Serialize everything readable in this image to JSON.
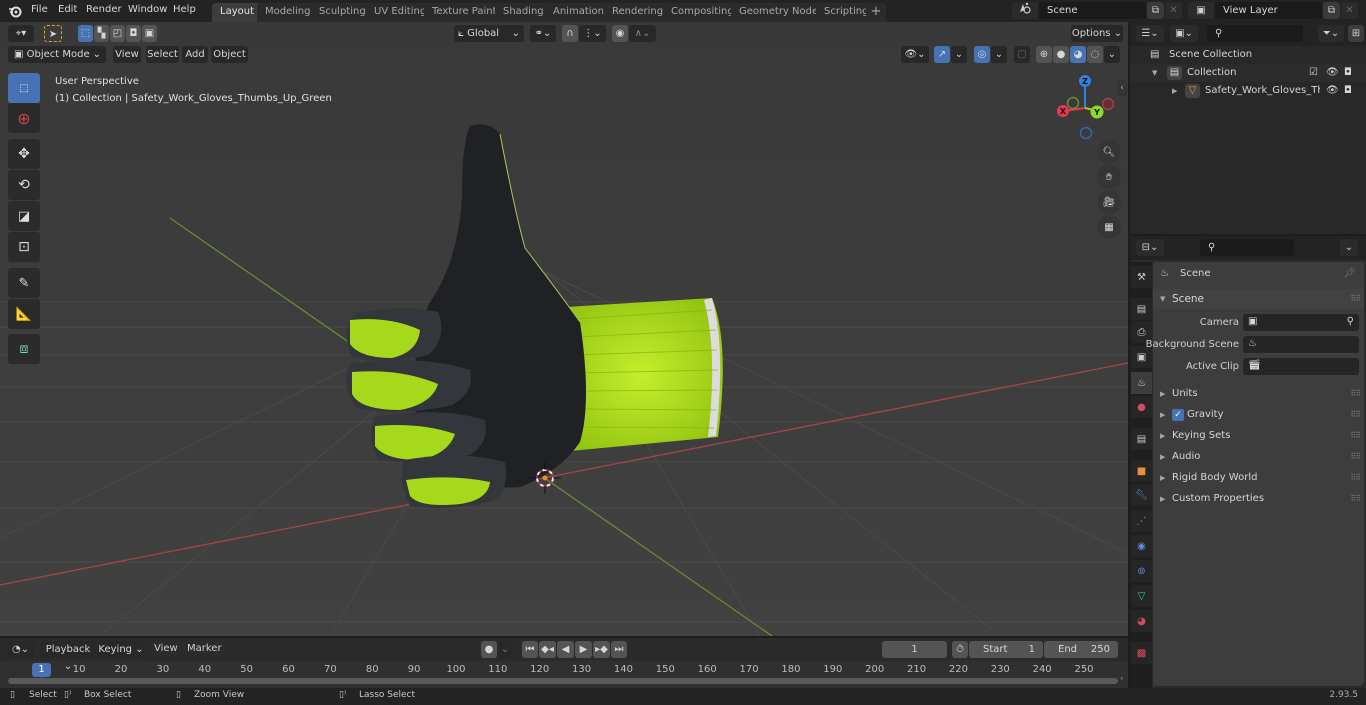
{
  "topbar": {
    "menus": [
      "File",
      "Edit",
      "Render",
      "Window",
      "Help"
    ],
    "workspaces": [
      "Layout",
      "Modeling",
      "Sculpting",
      "UV Editing",
      "Texture Paint",
      "Shading",
      "Animation",
      "Rendering",
      "Compositing",
      "Geometry Nodes",
      "Scripting"
    ],
    "active_workspace": "Layout",
    "add_workspace": "+",
    "scene_name": "Scene",
    "view_layer_name": "View Layer"
  },
  "viewport": {
    "mode": "Object Mode",
    "menus": [
      "View",
      "Select",
      "Add",
      "Object"
    ],
    "transform_orientation": "Global",
    "options_label": "Options",
    "view_name": "User Perspective",
    "object_info": "(1) Collection | Safety_Work_Gloves_Thumbs_Up_Green",
    "gizmo_axes": {
      "x": "X",
      "y": "Y",
      "z": "Z"
    },
    "colors": {
      "x_axis": "#e8384f",
      "y_axis": "#8bdc1e",
      "z_axis": "#2f83e0",
      "accent": "#4772b3",
      "glove_green": "#b5e61d",
      "glove_black": "#1f2124"
    }
  },
  "outliner": {
    "search_placeholder": "",
    "items": [
      {
        "label": "Scene Collection",
        "level": 0
      },
      {
        "label": "Collection",
        "level": 1,
        "checked": true
      },
      {
        "label": "Safety_Work_Gloves_Thu",
        "level": 2
      }
    ]
  },
  "properties": {
    "search_placeholder": "",
    "context_title": "Scene",
    "section_title": "Scene",
    "fields": [
      {
        "label": "Camera",
        "value": ""
      },
      {
        "label": "Background Scene",
        "value": ""
      },
      {
        "label": "Active Clip",
        "value": ""
      }
    ],
    "collapsed_panels": [
      {
        "label": "Units"
      },
      {
        "label": "Gravity",
        "checkbox": true
      },
      {
        "label": "Keying Sets"
      },
      {
        "label": "Audio"
      },
      {
        "label": "Rigid Body World"
      },
      {
        "label": "Custom Properties"
      }
    ],
    "tabs": [
      "tool",
      "render",
      "output",
      "view-layer",
      "scene",
      "world",
      "collection",
      "object",
      "modifiers",
      "particles",
      "physics",
      "constraints",
      "data",
      "material",
      "texture"
    ]
  },
  "timeline": {
    "menus": [
      "Playback",
      "Keying",
      "View",
      "Marker"
    ],
    "current_frame": "1",
    "start_label": "Start",
    "start_value": "1",
    "end_label": "End",
    "end_value": "250",
    "ticks": [
      "10",
      "20",
      "30",
      "40",
      "50",
      "60",
      "70",
      "80",
      "90",
      "100",
      "110",
      "120",
      "130",
      "140",
      "150",
      "160",
      "170",
      "180",
      "190",
      "200",
      "210",
      "220",
      "230",
      "240",
      "250"
    ],
    "playhead": "1"
  },
  "statusbar": {
    "hints": [
      "Select",
      "Box Select",
      "Zoom View",
      "Lasso Select"
    ],
    "version": "2.93.5"
  }
}
